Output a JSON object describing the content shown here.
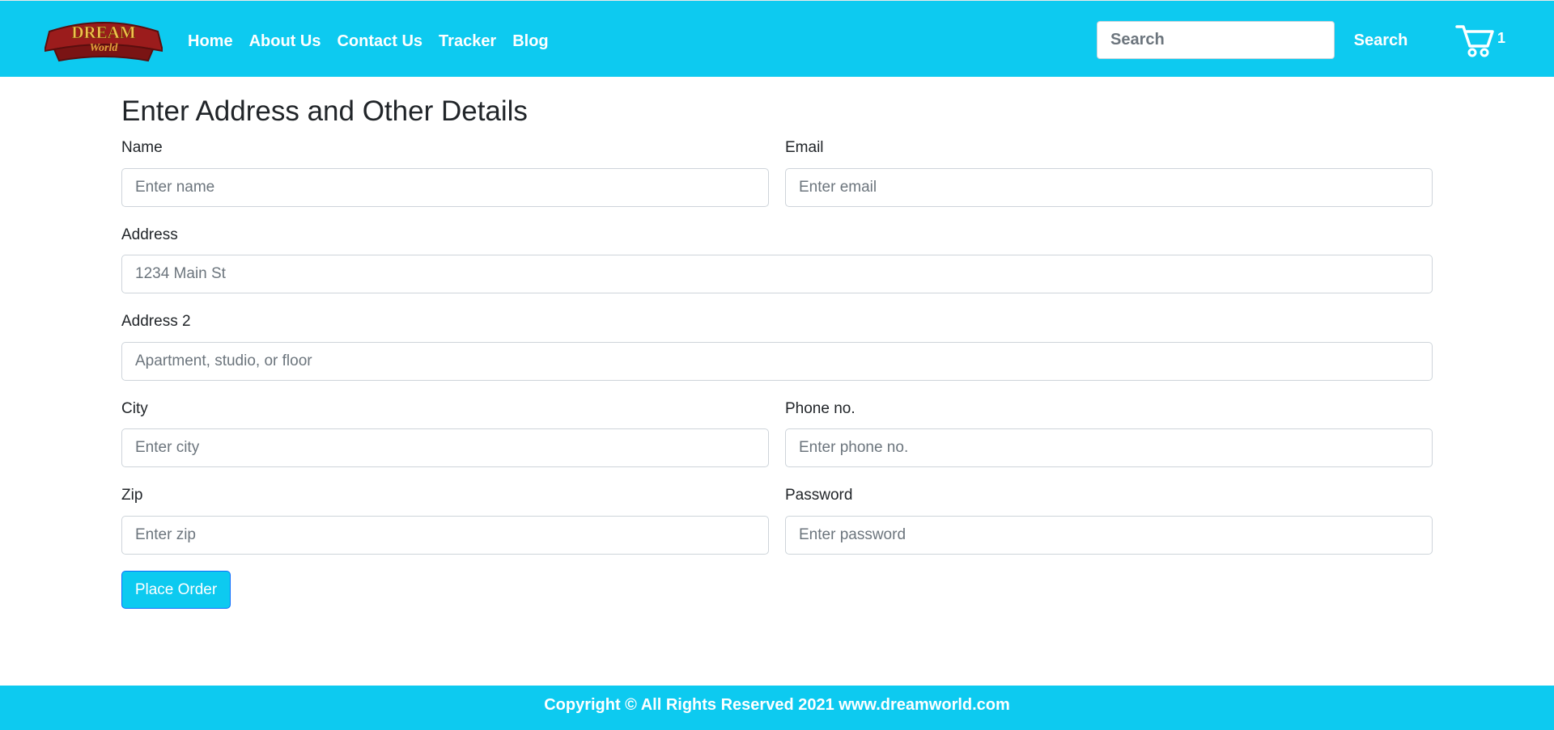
{
  "navbar": {
    "logo": {
      "alt": "Dream World logo",
      "text_top": "DREAM",
      "text_bottom": "World"
    },
    "links": [
      {
        "label": "Home"
      },
      {
        "label": "About Us"
      },
      {
        "label": "Contact Us"
      },
      {
        "label": "Tracker"
      },
      {
        "label": "Blog"
      }
    ],
    "search": {
      "placeholder": "Search",
      "button_label": "Search"
    },
    "cart": {
      "icon": "shopping-cart-icon",
      "count": "1"
    }
  },
  "form": {
    "heading": "Enter Address and Other Details",
    "name": {
      "label": "Name",
      "placeholder": "Enter name"
    },
    "email": {
      "label": "Email",
      "placeholder": "Enter email"
    },
    "address": {
      "label": "Address",
      "placeholder": "1234 Main St"
    },
    "address2": {
      "label": "Address 2",
      "placeholder": "Apartment, studio, or floor"
    },
    "city": {
      "label": "City",
      "placeholder": "Enter city"
    },
    "phone": {
      "label": "Phone no.",
      "placeholder": "Enter phone no."
    },
    "zip": {
      "label": "Zip",
      "placeholder": "Enter zip"
    },
    "password": {
      "label": "Password",
      "placeholder": "Enter password"
    },
    "submit_label": "Place Order"
  },
  "footer": {
    "text": "Copyright © All Rights Reserved 2021 www.dreamworld.com"
  },
  "colors": {
    "accent": "#0dcaf0",
    "border": "#ced4da",
    "logo_red": "#9b1c1c",
    "logo_gold": "#e0a23a"
  }
}
